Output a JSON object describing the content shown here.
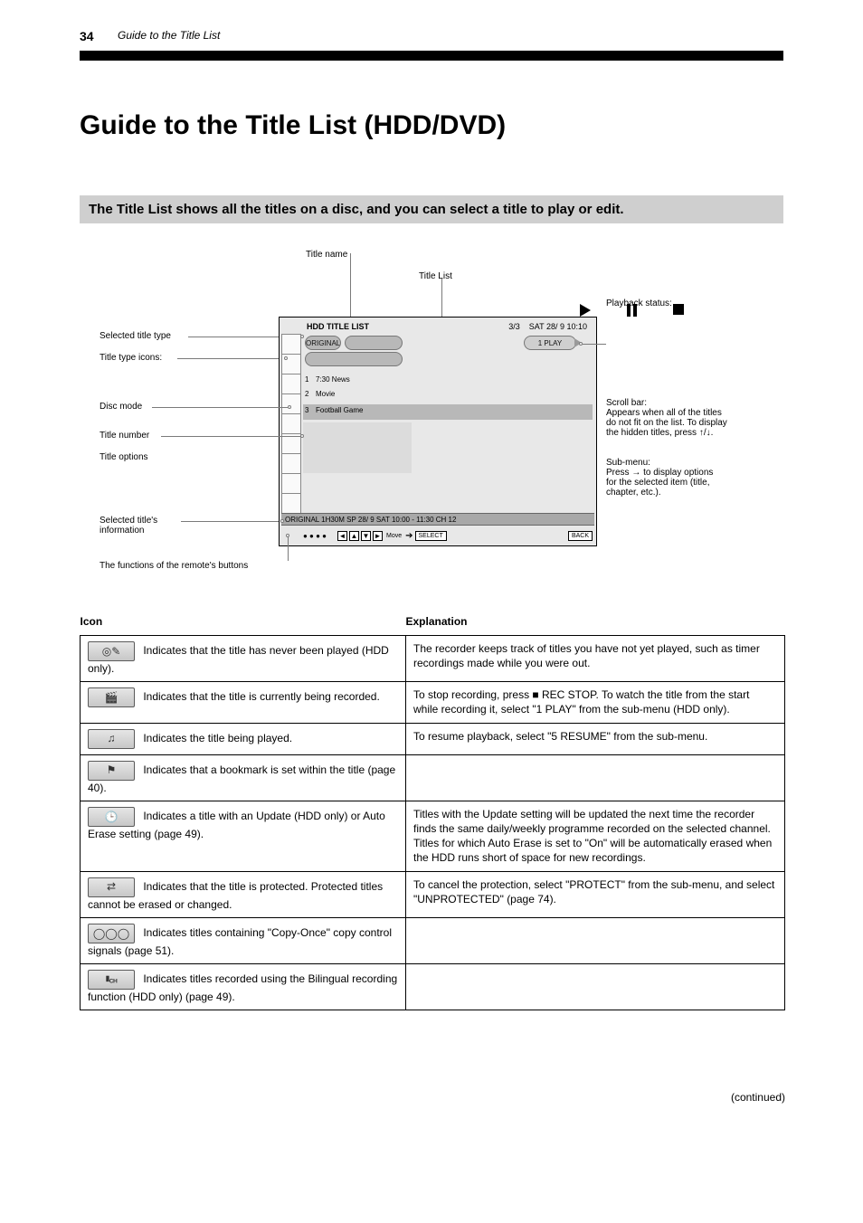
{
  "page_number": "34",
  "running_head": "Guide to the Title List",
  "title": "Guide to the Title List (HDD/DVD)",
  "intro_band": "The Title List shows all the titles on a disc, and you can select a title to play or edit.",
  "above_icons_note_play": "Play",
  "above_icons_note_pause": "Pause",
  "above_icons_note_stop": "Stop",
  "diagram": {
    "screen_title": "HDD TITLE LIST",
    "screen_title_num": "3/3",
    "screen_title_date": "SAT 28/ 9 10:10",
    "status_text": "ORIGINAL  1H30M  SP  28/ 9  SAT  10:00 - 11:30  CH 12",
    "hint_move": "Move",
    "hint_select": "SELECT",
    "hint_back": "BACK",
    "disc_mode_label": "ORIGINAL",
    "play_mode_label": "1 PLAY",
    "row_title_1": "7:30 News",
    "row_title_2": "Movie",
    "row_title_3": "Football Game",
    "callouts": {
      "c_left_1": "Selected title type",
      "c_left_2": "Title type icons:",
      "c_left_3": "Disc mode",
      "c_left_4": "Title number",
      "c_left_5": "Title options",
      "c_left_6": "Selected title's\ninformation",
      "c_left_7": "The functions of the remote's buttons",
      "c_top_1": "Title name",
      "c_top_2": "Title List",
      "c_right_1": "Playback status:",
      "c_right_2": "Scroll bar:\nAppears when all of the titles\ndo not fit on the list. To display\nthe hidden titles, press ↑/↓.",
      "c_right_3": "Sub-menu:\nPress → to display options\nfor the selected item (title,\nchapter, etc.)."
    }
  },
  "table": {
    "header_left": "Icon",
    "header_right": "Explanation",
    "rows": [
      {
        "glyph": "disc-cam-icon",
        "left": "Indicates that the title has never been played (HDD only).",
        "right": "The recorder keeps track of titles you have not yet played, such as timer recordings made while you were out."
      },
      {
        "glyph": "clapper-icon",
        "left": "Indicates that the title is currently being recorded.",
        "right": "To stop recording, press ■ REC STOP. To watch the title from the start while recording it, select \"1 PLAY\" from the sub-menu (HDD only)."
      },
      {
        "glyph": "music-icon",
        "left": "Indicates the title being played.",
        "right": "To resume playback, select \"5 RESUME\" from the sub-menu."
      },
      {
        "glyph": "flag-icon",
        "left": "Indicates that a bookmark is set within the title (page 40).",
        "right": ""
      },
      {
        "glyph": "clock-icon",
        "left": "Indicates a title with an Update (HDD only) or Auto Erase setting (page 49).",
        "right": "Titles with the Update setting will be updated the next time the recorder finds the same daily/weekly programme recorded on the selected channel.\nTitles for which Auto Erase is set to \"On\" will be automatically erased when the HDD runs short of space for new recordings."
      },
      {
        "glyph": "transfer-icon",
        "left": "Indicates that the title is protected.\nProtected titles cannot be erased or changed.",
        "right": "To cancel the protection, select \"PROTECT\" from the sub-menu, and select \"UNPROTECTED\" (page 74)."
      },
      {
        "glyph": "rings-icon",
        "left": "Indicates titles containing \"Copy-Once\" copy control signals (page 51).",
        "right": ""
      },
      {
        "glyph": "ch-icon",
        "left": "Indicates titles recorded using the Bilingual recording function (HDD only) (page 49).",
        "right": ""
      }
    ]
  },
  "continued_text": "(continued)"
}
